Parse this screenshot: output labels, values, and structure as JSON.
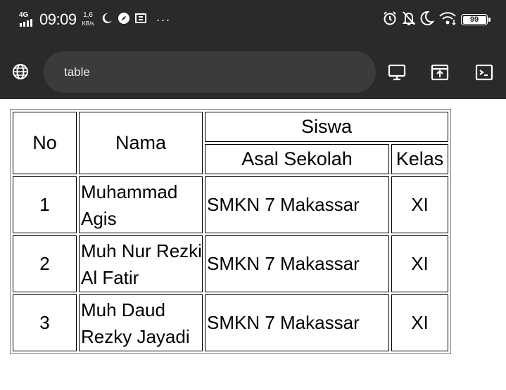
{
  "status_bar": {
    "network": "4G",
    "time": "09:09",
    "speed_value": "1,6",
    "speed_unit": "KB/s",
    "more": "···",
    "battery_level": "99",
    "icons_left": [
      "moon-icon",
      "compass-icon",
      "screenshot-icon"
    ],
    "icons_right": [
      "alarm-icon",
      "bell-off-icon",
      "moon-icon",
      "wifi-icon",
      "battery-icon"
    ]
  },
  "toolbar": {
    "url": "table",
    "icons": [
      "globe-icon",
      "desktop-icon",
      "share-icon",
      "console-icon"
    ]
  },
  "table": {
    "headers": {
      "no": "No",
      "nama": "Nama",
      "group": "Siswa",
      "asal": "Asal Sekolah",
      "kelas": "Kelas"
    },
    "rows": [
      {
        "no": "1",
        "nama": "Muhammad Agis",
        "asal": "SMKN 7 Makassar",
        "kelas": "XI"
      },
      {
        "no": "2",
        "nama": "Muh Nur Rezki Al Fatir",
        "asal": "SMKN 7 Makassar",
        "kelas": "XI"
      },
      {
        "no": "3",
        "nama": "Muh Daud Rezky Jayadi",
        "asal": "SMKN 7 Makassar",
        "kelas": "XI"
      }
    ]
  },
  "colors": {
    "chrome_bg": "#2a2a2a",
    "url_bg": "#3b3b3b",
    "page_bg": "#ffffff"
  }
}
